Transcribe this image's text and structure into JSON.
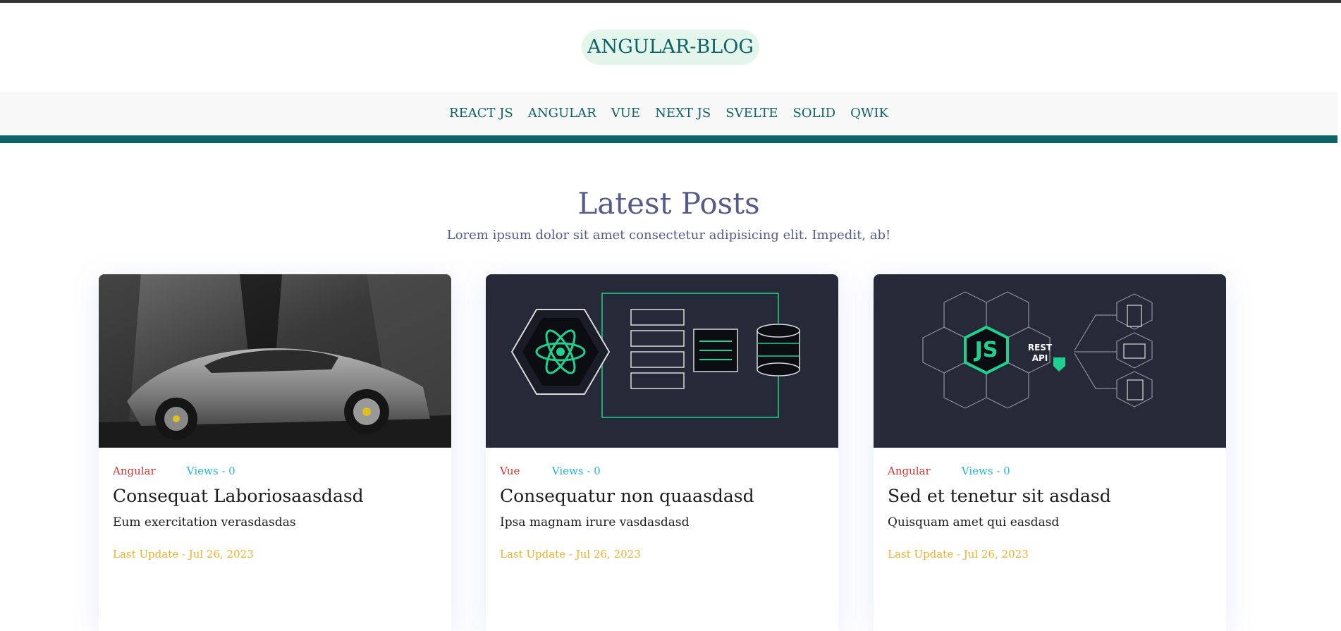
{
  "brand": {
    "name": "ANGULAR-BLOG"
  },
  "nav": {
    "items": [
      {
        "label": "REACT JS"
      },
      {
        "label": "ANGULAR"
      },
      {
        "label": "VUE"
      },
      {
        "label": "NEXT JS"
      },
      {
        "label": "SVELTE"
      },
      {
        "label": "SOLID"
      },
      {
        "label": "QWIK"
      }
    ]
  },
  "colors": {
    "accent": "#0d6366",
    "brand_bg": "#e4f6ec",
    "heading": "#555b8d",
    "category": "#d63333",
    "views": "#1eb8d2",
    "date": "#f2b024"
  },
  "main": {
    "title": "Latest Posts",
    "subtitle": "Lorem ipsum dolor sit amet consectetur adipisicing elit. Impedit, ab!",
    "posts": [
      {
        "category": "Angular",
        "views": "Views - 0",
        "title": "Consequat Laboriosaasdasd",
        "description": "Eum exercitation verasdasdas",
        "updated": "Last Update - Jul 26, 2023",
        "image": "sports-car-photo"
      },
      {
        "category": "Vue",
        "views": "Views - 0",
        "title": "Consequatur non quaasdasd",
        "description": "Ipsa magnam irure vasdasdasd",
        "updated": "Last Update - Jul 26, 2023",
        "image": "react-server-database-illustration"
      },
      {
        "category": "Angular",
        "views": "Views - 0",
        "title": "Sed et tenetur sit asdasd",
        "description": "Quisquam amet qui easdasd",
        "updated": "Last Update - Jul 26, 2023",
        "image": "nodejs-rest-api-illustration",
        "image_text": [
          "JS",
          "REST",
          "API"
        ]
      }
    ]
  }
}
